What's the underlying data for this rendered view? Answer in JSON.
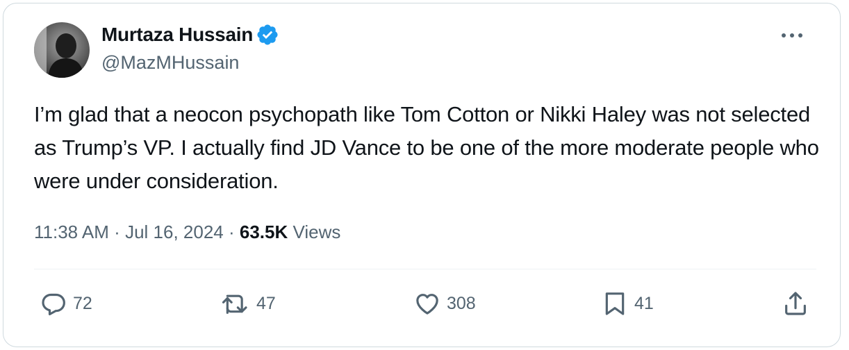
{
  "author": {
    "name": "Murtaza Hussain",
    "handle": "@MazMHussain",
    "verified": true,
    "verified_color": "#1d9bf0"
  },
  "tweet": {
    "text": "I’m glad that a neocon psychopath like Tom Cotton or Nikki Haley was not selected as Trump’s VP. I actually find JD Vance to be one of the more moderate people who were under consideration.",
    "time": "11:38 AM",
    "date": "Jul 16, 2024",
    "separator": "·",
    "views_count": "63.5K",
    "views_label": "Views"
  },
  "actions": {
    "replies": "72",
    "reposts": "47",
    "likes": "308",
    "bookmarks": "41"
  },
  "icons": {
    "more": "more-horizontal-icon",
    "reply": "reply-bubble-icon",
    "repost": "repost-icon",
    "like": "heart-icon",
    "bookmark": "bookmark-icon",
    "share": "share-upload-icon"
  },
  "colors": {
    "text_primary": "#0f1419",
    "text_secondary": "#536471",
    "border": "#cfd9de",
    "divider": "#eff3f4"
  }
}
